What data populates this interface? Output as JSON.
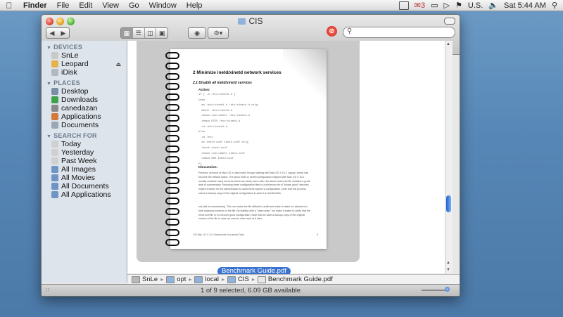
{
  "menubar": {
    "app": "Finder",
    "items": [
      "File",
      "Edit",
      "View",
      "Go",
      "Window",
      "Help"
    ],
    "badge": "3",
    "language": "U.S.",
    "clock": "Sat 5:44 AM"
  },
  "window": {
    "title": "CIS",
    "search_placeholder": "",
    "nav_back": "◀",
    "nav_forward": "▶"
  },
  "sidebar": {
    "sections": [
      {
        "header": "DEVICES",
        "items": [
          {
            "label": "SnLe",
            "icon": "harddisk-icon",
            "color": "#c9c9c9"
          },
          {
            "label": "Leopard",
            "icon": "harddisk-icon",
            "color": "#e3b34a",
            "eject": "⏏"
          },
          {
            "label": "iDisk",
            "icon": "idisk-icon",
            "color": "#b0b8c2"
          }
        ]
      },
      {
        "header": "PLACES",
        "items": [
          {
            "label": "Desktop",
            "icon": "desktop-icon",
            "color": "#7a8ea6"
          },
          {
            "label": "Downloads",
            "icon": "downloads-icon",
            "color": "#3fa14a"
          },
          {
            "label": "canedazan",
            "icon": "home-icon",
            "color": "#8a8a8a"
          },
          {
            "label": "Applications",
            "icon": "applications-icon",
            "color": "#d17a3a"
          },
          {
            "label": "Documents",
            "icon": "documents-icon",
            "color": "#9aa7b5"
          }
        ]
      },
      {
        "header": "SEARCH FOR",
        "items": [
          {
            "label": "Today",
            "icon": "clock-icon",
            "color": "#d0d0d0"
          },
          {
            "label": "Yesterday",
            "icon": "clock-icon",
            "color": "#d0d0d0"
          },
          {
            "label": "Past Week",
            "icon": "clock-icon",
            "color": "#d0d0d0"
          },
          {
            "label": "All Images",
            "icon": "smart-folder-icon",
            "color": "#6f95c4"
          },
          {
            "label": "All Movies",
            "icon": "smart-folder-icon",
            "color": "#6f95c4"
          },
          {
            "label": "All Documents",
            "icon": "smart-folder-icon",
            "color": "#6f95c4"
          },
          {
            "label": "All Applications",
            "icon": "smart-folder-icon",
            "color": "#6f95c4"
          }
        ]
      }
    ]
  },
  "preview": {
    "heading": "2  Minimize inetd/xinetd network services",
    "subheading": "2.1   Disable all inetd/xinetd services",
    "action": "Action:",
    "code": "if [ -d /etc/xinetd.d ]\nthen\n  mv /etc/xinetd.d /etc/xinetd.d.orig\n  mkdir /etc/xinetd.d\n  chown root:wheel /etc/xinetd.d\n  chmod 0755 /etc/xinetd.d\n  cd /etc/xinetd.d\nelse\n  cd /etc\n  mv inetd.conf inetd.conf.orig\n  touch inetd.conf\n  chown root:wheel inetd.conf\n  chmod 600 inetd.conf\nfi",
    "discussion": "Discussion:",
    "para1": "Previous versions of Mac OS X used inetd, though starting with Mac OS X 10.2 Jaguar, xinetd has become the default option. The stock inetd or xinetd configuration shipped with Mac OS X 10.2 usually contains many services which are rarely used. Also, the stock inetd.conf file contains a great deal of commentary. Reducing these configuration files to a minimum set of \"known good\" services makes it easier for the administrator to audit these system's configuration. Note that this process saves a backup copy of the original configuration in case it is needed later.",
    "para2": "use (list of commentary). This can make the file difficult to audit and make it easier for attackers to hide malicious services in the file. By starting with a \"clean slate,\" we make it easier to verify that the inetd.conf file is in a known good configuration. Note that we save a backup copy of the original version of the file in case we need to refer back to it later.",
    "footer_left": "CIS Mac OS X 10.2 Benchmark Document Draft",
    "footer_right": "8",
    "file_label": "Benchmark Guide.pdf"
  },
  "pathbar": [
    {
      "label": "SnLe",
      "icon": "harddisk-icon",
      "color": "#b9b9b9"
    },
    {
      "label": "opt",
      "icon": "folder-icon",
      "color": "#8fb3db"
    },
    {
      "label": "local",
      "icon": "folder-icon",
      "color": "#8fb3db"
    },
    {
      "label": "CIS",
      "icon": "folder-icon",
      "color": "#8fb3db"
    },
    {
      "label": "Benchmark Guide.pdf",
      "icon": "pdf-icon",
      "color": "#e9e9e9"
    }
  ],
  "status": "1 of 9 selected, 6.09 GB available",
  "colors": {
    "selection": "#3a72cf",
    "sidebar": "#dde4ec"
  }
}
